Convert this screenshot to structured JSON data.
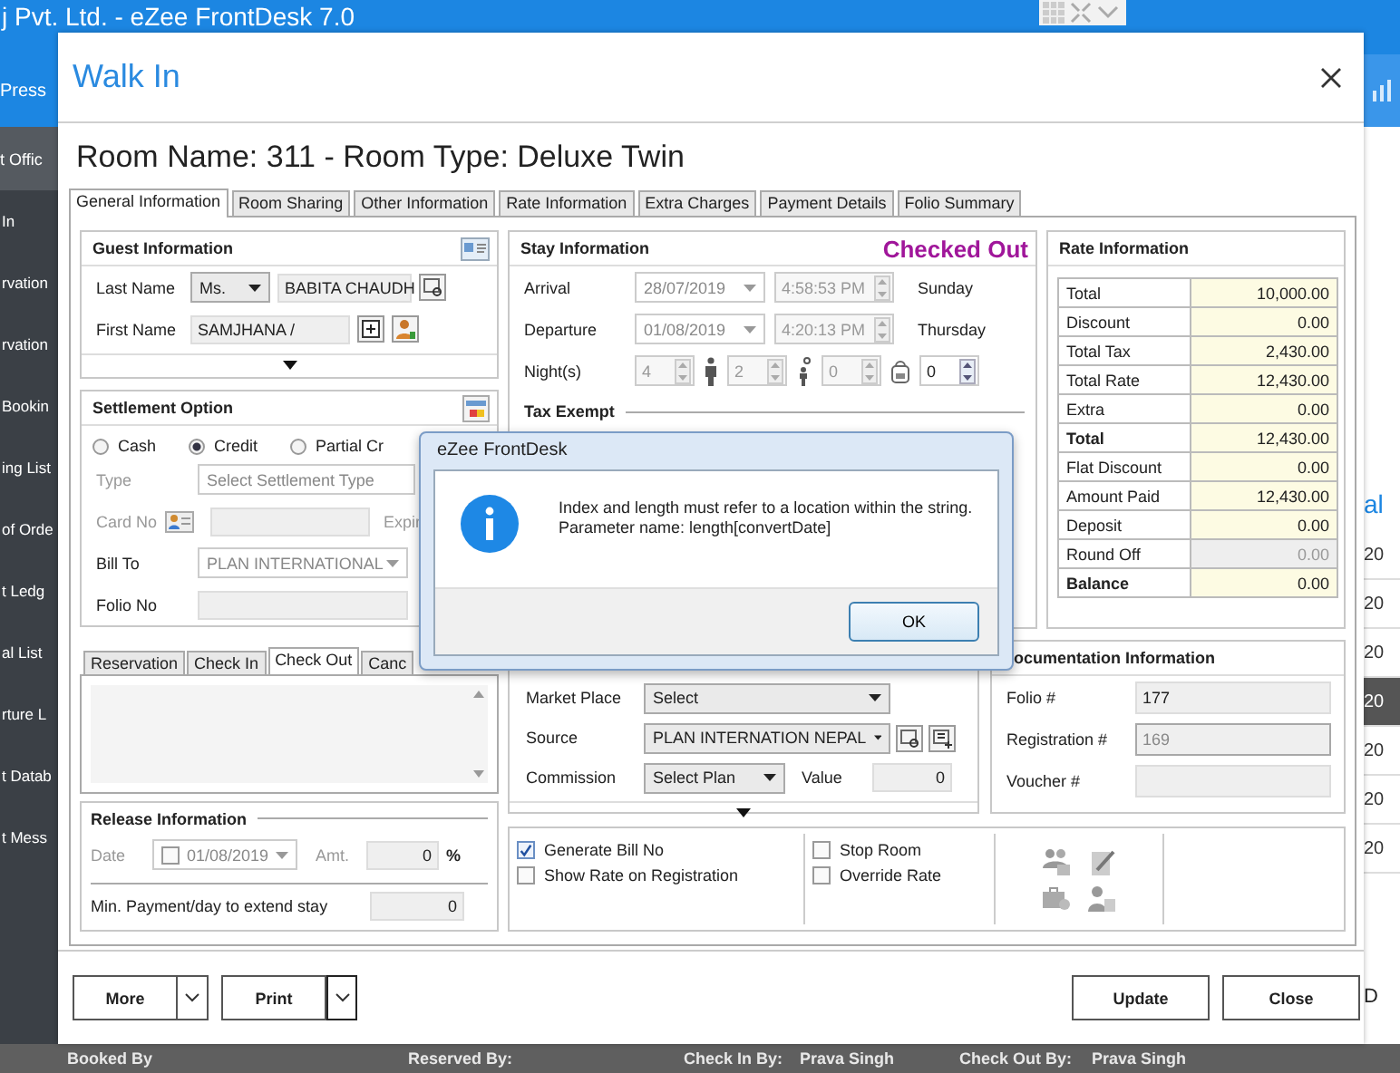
{
  "app": {
    "title": "j Pvt. Ltd. - eZee FrontDesk 7.0",
    "menu_label": "Press",
    "section": "t Offic",
    "sidebar_items": [
      {
        "label": "In"
      },
      {
        "label": "rvation"
      },
      {
        "label": "rvation"
      },
      {
        "label": "Bookin"
      },
      {
        "label": "ing List"
      },
      {
        "label": "of Orde"
      },
      {
        "label": "t Ledg"
      },
      {
        "label": "al List"
      },
      {
        "label": "rture L"
      },
      {
        "label": "t Datab"
      },
      {
        "label": "t Mess"
      }
    ],
    "right_heading": "al",
    "right_rows": [
      {
        "label": "20",
        "selected": false
      },
      {
        "label": "20",
        "selected": false
      },
      {
        "label": "20",
        "selected": false
      },
      {
        "label": "20",
        "selected": true
      },
      {
        "label": "20",
        "selected": false
      },
      {
        "label": "20",
        "selected": false
      },
      {
        "label": "20",
        "selected": false
      }
    ],
    "right_footer": "D",
    "status_bar": [
      {
        "label": "Booked By"
      },
      {
        "label": "Reserved By:"
      },
      {
        "label": "Check In By:"
      },
      {
        "label": "Prava Singh"
      },
      {
        "label": "Check Out By:"
      },
      {
        "label": "Prava Singh"
      }
    ]
  },
  "walk_in": {
    "title": "Walk In",
    "room_heading": "Room Name: 311 - Room Type: Deluxe Twin",
    "tabs": [
      {
        "label": "General Information",
        "selected": true
      },
      {
        "label": "Room Sharing",
        "selected": false
      },
      {
        "label": "Other Information",
        "selected": false
      },
      {
        "label": "Rate Information",
        "selected": false
      },
      {
        "label": "Extra Charges",
        "selected": false
      },
      {
        "label": "Payment Details",
        "selected": false
      },
      {
        "label": "Folio Summary",
        "selected": false
      }
    ],
    "guest": {
      "title": "Guest Information",
      "last_name_label": "Last Name",
      "salutation": "Ms.",
      "last_name": "BABITA CHAUDH",
      "first_name_label": "First Name",
      "first_name": "SAMJHANA  /"
    },
    "settlement": {
      "title": "Settlement Option",
      "payment_modes": [
        {
          "label": "Cash",
          "selected": false
        },
        {
          "label": "Credit",
          "selected": true
        },
        {
          "label": "Partial Cr",
          "selected": false
        }
      ],
      "type_label": "Type",
      "type_value": "Select Settlement Type",
      "card_label": "Card No",
      "expiry_label": "Expir",
      "bill_to_label": "Bill To",
      "bill_to": "PLAN INTERNATIONAL",
      "folio_label": "Folio No"
    },
    "sub_tabs": [
      {
        "label": "Reservation",
        "selected": false
      },
      {
        "label": "Check In",
        "selected": false
      },
      {
        "label": "Check Out",
        "selected": true
      },
      {
        "label": "Canc",
        "selected": false
      }
    ],
    "release": {
      "title": "Release Information",
      "date_label": "Date",
      "date_enabled": false,
      "date": "01/08/2019",
      "amount_label": "Amt.",
      "amount": "0",
      "percent": "%",
      "min_payment_label": "Min. Payment/day to extend stay",
      "min_payment": "0"
    },
    "stay": {
      "title": "Stay Information",
      "status": "Checked Out",
      "rows": [
        {
          "label": "Arrival",
          "date": "28/07/2019",
          "time": "4:58:53 PM",
          "day": "Sunday"
        },
        {
          "label": "Departure",
          "date": "01/08/2019",
          "time": "4:20:13 PM",
          "day": "Thursday"
        }
      ],
      "nights_label": "Night(s)",
      "nights": "4",
      "adults": "2",
      "children": "0",
      "extra": "0",
      "tax_exempt": "Tax Exempt"
    },
    "rates": {
      "title": "Rate Information",
      "rows": [
        {
          "label": "Total",
          "value": "10,000.00",
          "bold": false,
          "disabled": false
        },
        {
          "label": "Discount",
          "value": "0.00",
          "bold": false,
          "disabled": false
        },
        {
          "label": "Total Tax",
          "value": "2,430.00",
          "bold": false,
          "disabled": false
        },
        {
          "label": "Total Rate",
          "value": "12,430.00",
          "bold": false,
          "disabled": false
        },
        {
          "label": "Extra",
          "value": "0.00",
          "bold": false,
          "disabled": false
        },
        {
          "label": "Total",
          "value": "12,430.00",
          "bold": true,
          "disabled": false
        },
        {
          "label": "Flat Discount",
          "value": "0.00",
          "bold": false,
          "disabled": false
        },
        {
          "label": "Amount Paid",
          "value": "12,430.00",
          "bold": false,
          "disabled": false
        },
        {
          "label": "Deposit",
          "value": "0.00",
          "bold": false,
          "disabled": false
        },
        {
          "label": "Round Off",
          "value": "0.00",
          "bold": false,
          "disabled": true
        },
        {
          "label": "Balance",
          "value": "0.00",
          "bold": true,
          "disabled": false
        }
      ]
    },
    "booking": {
      "market_label": "Market Place",
      "market": "Select",
      "source_label": "Source",
      "source": "PLAN INTERNATION NEPAL",
      "commission_label": "Commission",
      "commission": "Select Plan",
      "value_label": "Value",
      "value": "0"
    },
    "documentation": {
      "title": "ocumentation Information",
      "fields": [
        {
          "label": "Folio #",
          "value": "177",
          "disabled": false
        },
        {
          "label": "Registration #",
          "value": "169",
          "disabled": true
        },
        {
          "label": "Voucher #",
          "disabled": false
        }
      ]
    },
    "option_groups": [
      {
        "items": [
          {
            "label": "Generate Bill No",
            "checked": true
          },
          {
            "label": "Show Rate on Registration",
            "checked": false
          }
        ]
      },
      {
        "items": [
          {
            "label": "Stop Room",
            "checked": false
          },
          {
            "label": "Override Rate",
            "checked": false
          }
        ]
      }
    ],
    "buttons_left": [
      {
        "label": "More"
      },
      {
        "label": "Print"
      }
    ],
    "buttons_right": [
      {
        "label": "Update"
      },
      {
        "label": "Close"
      }
    ]
  },
  "message_box": {
    "title": "eZee FrontDesk",
    "lines": [
      "Index and length must refer to a location within the string.",
      "Parameter name: length[convertDate]"
    ],
    "button": "OK"
  }
}
